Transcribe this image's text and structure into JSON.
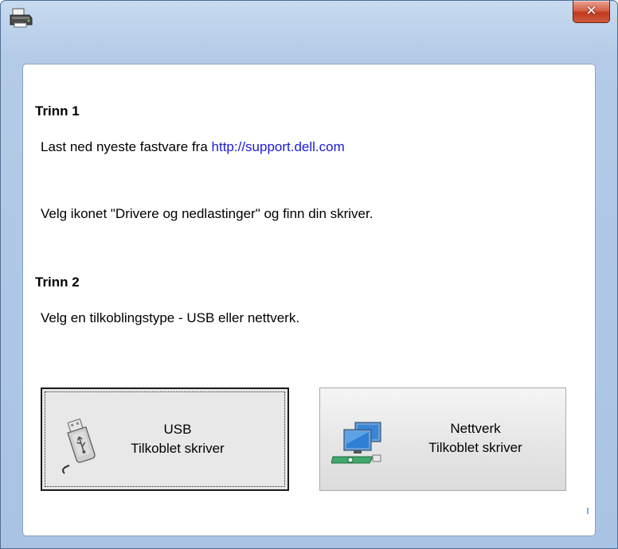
{
  "titlebar": {
    "close_glyph": "✕"
  },
  "step1": {
    "heading": "Trinn 1",
    "download_text": "Last ned nyeste fastvare fra ",
    "download_link": "http://support.dell.com",
    "instruction": "Velg ikonet \"Drivere og nedlastinger\" og finn din skriver."
  },
  "step2": {
    "heading": "Trinn 2",
    "instruction": "Velg en tilkoblingstype - USB eller nettverk."
  },
  "buttons": {
    "usb": {
      "line1": "USB",
      "line2": "Tilkoblet skriver",
      "icon": "usb-drive-icon"
    },
    "network": {
      "line1": "Nettverk",
      "line2": "Tilkoblet skriver",
      "icon": "network-computers-icon"
    }
  },
  "colors": {
    "link": "#1a1ad6",
    "close_button": "#c7412a",
    "titlebar": "#b4cbe7"
  }
}
